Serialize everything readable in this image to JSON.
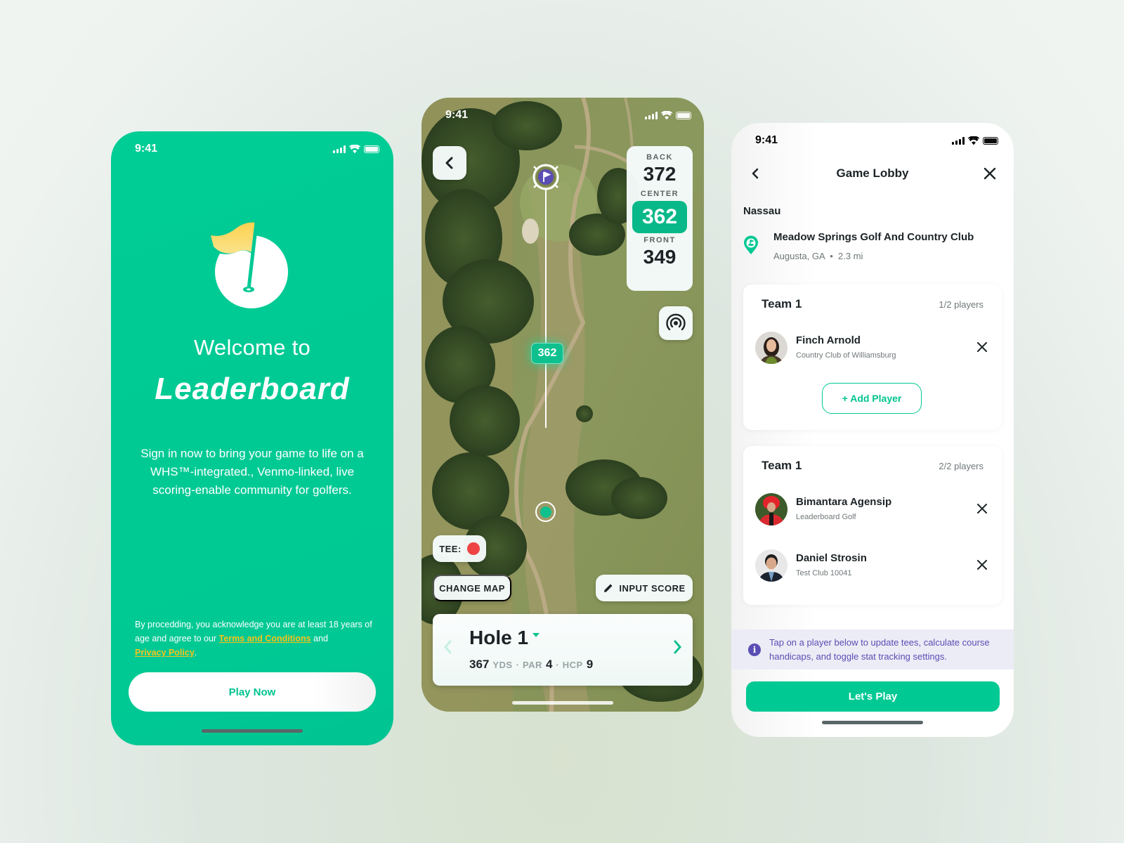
{
  "colors": {
    "brand_green": "#00c994",
    "link_yellow": "#f7c31c",
    "info_purple": "#5a4db4",
    "tee_red": "#ef4444"
  },
  "welcome_screen": {
    "status_time": "9:41",
    "logo_icon": "golf-flag-hole-icon",
    "welcome_text": "Welcome to",
    "brand_name": "Leaderboard",
    "description": "Sign in now to bring your game to life on a WHS™-integrated., Venmo-linked, live scoring-enable community for golfers.",
    "legal_prefix": "By procedding, you acknowledge you are  at least 18 years of age and agree to our ",
    "terms_link": "Terms and Conditions",
    "legal_and": " and ",
    "privacy_link": "Privacy Policy",
    "legal_suffix": ".",
    "play_now_button": "Play Now"
  },
  "map_screen": {
    "status_time": "9:41",
    "back_icon": "chevron-left-icon",
    "distances": {
      "back_label": "BACK",
      "back_value": "372",
      "center_label": "CENTER",
      "center_value": "362",
      "front_label": "FRONT",
      "front_value": "349"
    },
    "radar_icon": "location-radar-icon",
    "distance_chip": "362",
    "tee_label": "TEE:",
    "change_map_button": "CHANGE MAP",
    "input_score_button": "INPUT SCORE",
    "hole": {
      "title": "Hole 1",
      "yards": "367",
      "yards_unit": "YDS",
      "par_label": "PAR",
      "par": "4",
      "hcp_label": "HCP",
      "hcp": "9",
      "separator": "·"
    }
  },
  "lobby_screen": {
    "status_time": "9:41",
    "title": "Game Lobby",
    "game_type": "Nassau",
    "course": {
      "name": "Meadow Springs Golf And Country Club",
      "location": "Augusta, GA",
      "distance": "2.3 mi",
      "separator": "•"
    },
    "teams": [
      {
        "name": "Team 1",
        "count": "1/2 players",
        "players": [
          {
            "name": "Finch Arnold",
            "club": "Country Club of Williamsburg"
          }
        ],
        "add_player_button": "+ Add Player"
      },
      {
        "name": "Team 1",
        "count": "2/2 players",
        "players": [
          {
            "name": "Bimantara Agensip",
            "club": "Leaderboard Golf"
          },
          {
            "name": "Daniel Strosin",
            "club": "Test Club 10041"
          }
        ]
      }
    ],
    "info_text": "Tap on a player below to update tees, calculate course handicaps, and toggle stat tracking settings.",
    "info_icon_glyph": "i",
    "lets_play_button": "Let's Play"
  }
}
